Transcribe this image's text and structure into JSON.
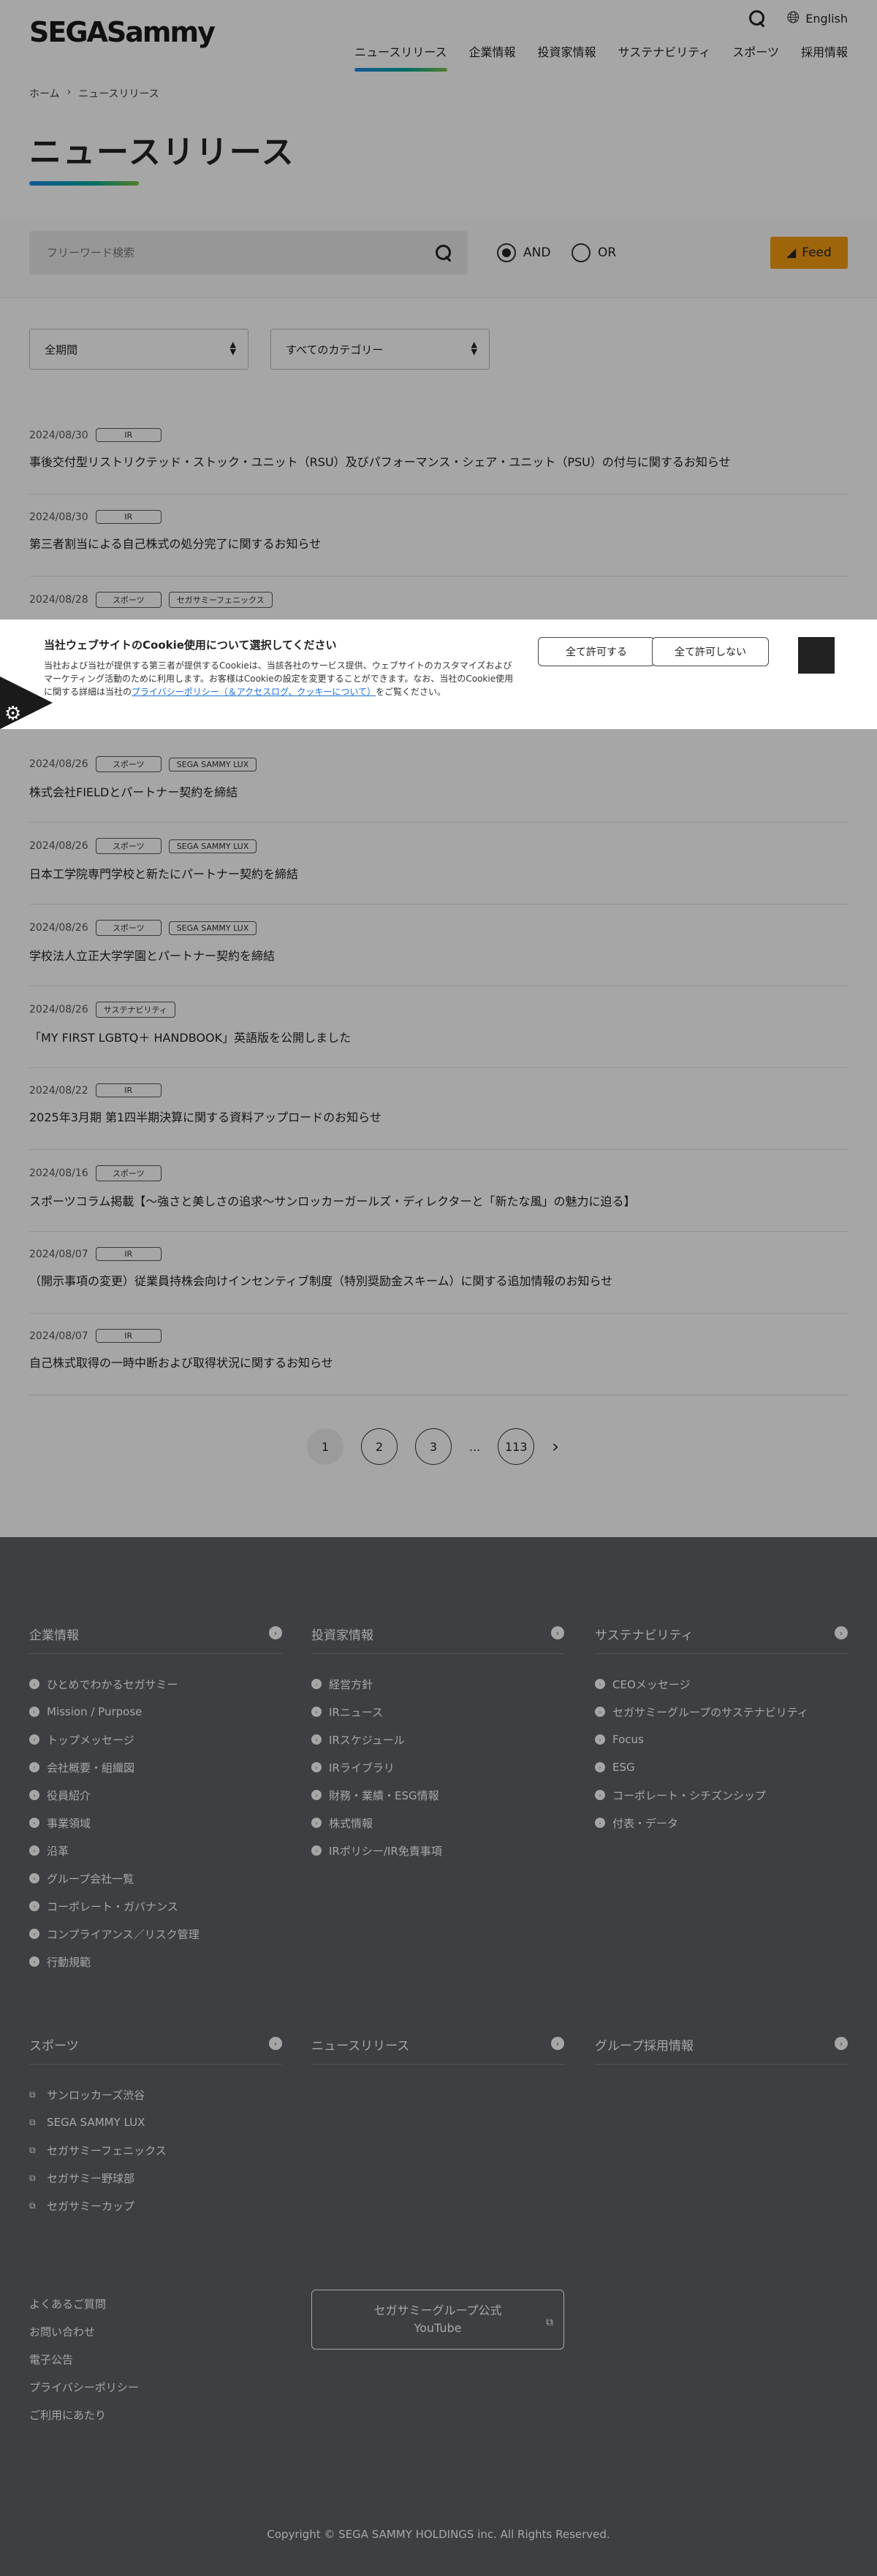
{
  "header": {
    "logo": "SEGASammy",
    "lang": "English",
    "nav": [
      "ニュースリリース",
      "企業情報",
      "投資家情報",
      "サステナビリティ",
      "スポーツ",
      "採用情報"
    ]
  },
  "breadcrumb": [
    "ホーム",
    "ニュースリリース"
  ],
  "page_title": "ニュースリリース",
  "search": {
    "placeholder": "フリーワード検索",
    "and_label": "AND",
    "or_label": "OR",
    "feed_label": "Feed"
  },
  "filters": {
    "period": "全期間",
    "category": "すべてのカテゴリー"
  },
  "news": [
    {
      "date": "2024/08/30",
      "tags": [
        "IR"
      ],
      "title": "事後交付型リストリクテッド・ストック・ユニット（RSU）及びパフォーマンス・シェア・ユニット（PSU）の付与に関するお知らせ"
    },
    {
      "date": "2024/08/30",
      "tags": [
        "IR"
      ],
      "title": "第三者割当による自己株式の処分完了に関するお知らせ"
    },
    {
      "date": "2024/08/28",
      "tags": [
        "スポーツ",
        "セガサミーフェニックス"
      ],
      "title": ""
    },
    {
      "date": "2024/08/26",
      "tags": [
        "スポーツ",
        "SEGA SAMMY LUX"
      ],
      "title": "株式会社FIELDとパートナー契約を締結"
    },
    {
      "date": "2024/08/26",
      "tags": [
        "スポーツ",
        "SEGA SAMMY LUX"
      ],
      "title": "日本工学院専門学校と新たにパートナー契約を締結"
    },
    {
      "date": "2024/08/26",
      "tags": [
        "スポーツ",
        "SEGA SAMMY LUX"
      ],
      "title": "学校法人立正大学学園とパートナー契約を締結"
    },
    {
      "date": "2024/08/26",
      "tags": [
        "サステナビリティ"
      ],
      "title": "「MY FIRST LGBTQ＋ HANDBOOK」英語版を公開しました"
    },
    {
      "date": "2024/08/22",
      "tags": [
        "IR"
      ],
      "title": "2025年3月期 第1四半期決算に関する資料アップロードのお知らせ"
    },
    {
      "date": "2024/08/16",
      "tags": [
        "スポーツ"
      ],
      "title": "スポーツコラム掲載【〜強さと美しさの追求〜サンロッカーガールズ・ディレクターと「新たな風」の魅力に迫る】"
    },
    {
      "date": "2024/08/07",
      "tags": [
        "IR"
      ],
      "title": "（開示事項の変更）従業員持株会向けインセンティブ制度（特別奨励金スキーム）に関する追加情報のお知らせ"
    },
    {
      "date": "2024/08/07",
      "tags": [
        "IR"
      ],
      "title": "自己株式取得の一時中断および取得状況に関するお知らせ"
    }
  ],
  "cookie": {
    "title": "当社ウェブサイトのCookie使用について選択してください",
    "text_before": "当社および当社が提供する第三者が提供するCookieは、当該各社のサービス提供、ウェブサイトのカスタマイズおよびマーケティング活動のために利用します。お客様はCookieの設定を変更することができます。なお、当社のCookie使用に関する詳細は当社の",
    "link": "プライバシーポリシー（＆アクセスログ、クッキーについて）",
    "text_after": "をご覧ください。",
    "allow_all": "全て許可する",
    "deny_all": "全て許可しない"
  },
  "pagination": {
    "pages": [
      "1",
      "2",
      "3"
    ],
    "ellipsis": "...",
    "last": "113"
  },
  "footer": {
    "columns": [
      {
        "title": "企業情報",
        "items": [
          "ひとめでわかるセガサミー",
          "Mission / Purpose",
          "トップメッセージ",
          "会社概要・組織図",
          "役員紹介",
          "事業領域",
          "沿革",
          "グループ会社一覧",
          "コーポレート・ガバナンス",
          "コンプライアンス／リスク管理",
          "行動規範"
        ]
      },
      {
        "title": "投資家情報",
        "items": [
          "経営方針",
          "IRニュース",
          "IRスケジュール",
          "IRライブラリ",
          "財務・業績・ESG情報",
          "株式情報",
          "IRポリシー/IR免責事項"
        ]
      },
      {
        "title": "サステナビリティ",
        "items": [
          "CEOメッセージ",
          "セガサミーグループのサステナビリティ",
          "Focus",
          "ESG",
          "コーポレート・シチズンシップ",
          "付表・データ"
        ]
      },
      {
        "title": "スポーツ",
        "items": [
          "サンロッカーズ渋谷",
          "SEGA SAMMY LUX",
          "セガサミーフェニックス",
          "セガサミー野球部",
          "セガサミーカップ"
        ]
      },
      {
        "title": "ニュースリリース",
        "items": []
      },
      {
        "title": "グループ採用情報",
        "items": []
      }
    ],
    "links": [
      "よくあるご質問",
      "お問い合わせ",
      "電子公告",
      "プライバシーポリシー",
      "ご利用にあたり"
    ],
    "youtube_line1": "セガサミーグループ公式",
    "youtube_line2": "YouTube",
    "copyright": "Copyright © SEGA SAMMY HOLDINGS inc. All Rights Reserved."
  }
}
